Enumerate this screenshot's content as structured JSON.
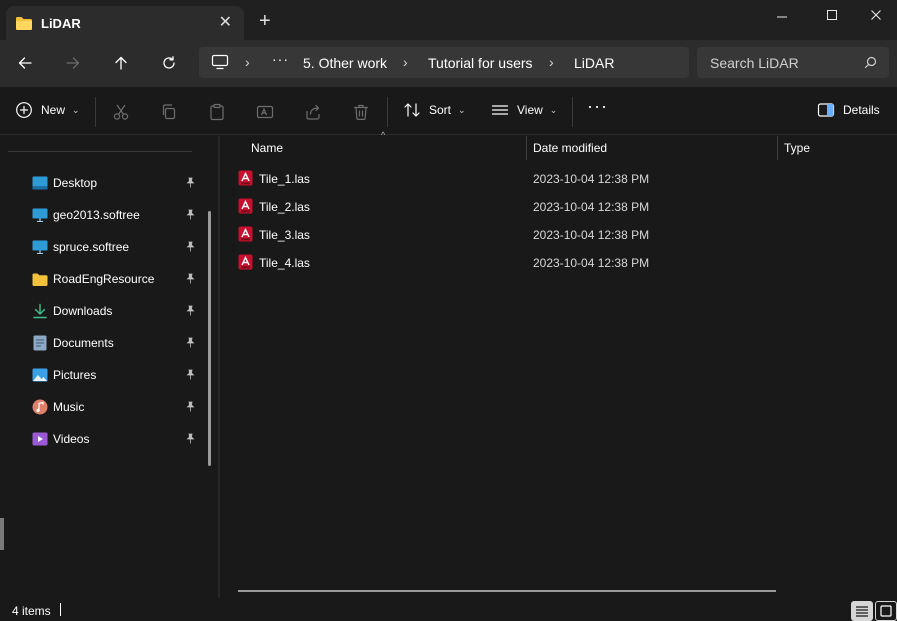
{
  "window": {
    "tab_title": "LiDAR",
    "tab_close": "✕",
    "new_tab": "+"
  },
  "navigation": {
    "breadcrumb": {
      "overflow": "···",
      "items": [
        "5. Other work",
        "Tutorial for users",
        "LiDAR"
      ]
    },
    "search_placeholder": "Search LiDAR"
  },
  "commandbar": {
    "new_label": "New",
    "sort_label": "Sort",
    "view_label": "View",
    "more_label": "···",
    "details_label": "Details"
  },
  "sidebar": {
    "items": [
      {
        "label": "Desktop",
        "icon": "desktop-icon",
        "pinned": true
      },
      {
        "label": "geo2013.softree",
        "icon": "network-drive-icon",
        "pinned": true
      },
      {
        "label": "spruce.softree",
        "icon": "network-drive-icon",
        "pinned": true
      },
      {
        "label": "RoadEngResource",
        "icon": "folder-icon",
        "pinned": true
      },
      {
        "label": "Downloads",
        "icon": "downloads-icon",
        "pinned": true
      },
      {
        "label": "Documents",
        "icon": "documents-icon",
        "pinned": true
      },
      {
        "label": "Pictures",
        "icon": "pictures-icon",
        "pinned": true
      },
      {
        "label": "Music",
        "icon": "music-icon",
        "pinned": true
      },
      {
        "label": "Videos",
        "icon": "videos-icon",
        "pinned": true
      }
    ]
  },
  "filelist": {
    "columns": [
      "Name",
      "Date modified",
      "Type"
    ],
    "files": [
      {
        "name": "Tile_1.las",
        "date": "2023-10-04 12:38 PM"
      },
      {
        "name": "Tile_2.las",
        "date": "2023-10-04 12:38 PM"
      },
      {
        "name": "Tile_3.las",
        "date": "2023-10-04 12:38 PM"
      },
      {
        "name": "Tile_4.las",
        "date": "2023-10-04 12:38 PM"
      }
    ]
  },
  "status": {
    "item_count": "4 items"
  },
  "colors": {
    "background": "#191919",
    "chrome": "#2c2c2c",
    "folder": "#f3c13a",
    "las_icon": "#c8102e"
  }
}
